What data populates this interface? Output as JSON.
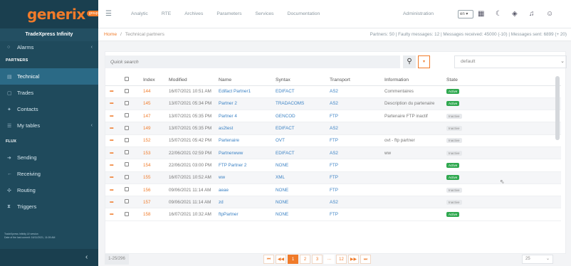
{
  "app": {
    "logo_text": "generix",
    "logo_badge": "group",
    "name": "TradeXpress Infinity",
    "version_line1": "TradeXpress Infinity UI version",
    "version_line2": "Date of the last commit: 16/11/2021, 11:05 AM"
  },
  "sidebar": {
    "alarms": "Alarms",
    "section_partners": "PARTNERS",
    "technical": "Technical",
    "trades": "Trades",
    "contacts": "Contacts",
    "my_tables": "My tables",
    "section_flux": "FLUX",
    "sending": "Sending",
    "receiving": "Receiving",
    "routing": "Routing",
    "triggers": "Triggers"
  },
  "topnav": {
    "items": [
      "Analytic",
      "RTE",
      "Archives",
      "Parameters",
      "Services",
      "Documentation"
    ],
    "administration": "Administration",
    "language": "en"
  },
  "breadcrumb": {
    "home": "Home",
    "separator": "/",
    "current": "Technical partners"
  },
  "stats": "Partners: 50   |   Faulty messages: 12   |   Messages received: 45000 (-10)   |   Messages sent: 6899 (+ 20)",
  "search": {
    "placeholder": "Quick search"
  },
  "view": {
    "selected": "default"
  },
  "table": {
    "headers": [
      "Index",
      "Modified",
      "Name",
      "Syntax",
      "Transport",
      "Information",
      "State"
    ],
    "rows": [
      {
        "index": "144",
        "modified": "16/07/2021 10:51 AM",
        "name": "Edifact Partner1",
        "syntax": "EDIFACT",
        "transport": "AS2",
        "information": "Commentaires",
        "state": "Active"
      },
      {
        "index": "145",
        "modified": "13/07/2021 05:34 PM",
        "name": "Partner 2",
        "syntax": "TRADACOMS",
        "transport": "AS2",
        "information": "Description du partenaire",
        "state": "Active"
      },
      {
        "index": "147",
        "modified": "13/07/2021 05:35 PM",
        "name": "Partner 4",
        "syntax": "GENCOD",
        "transport": "FTP",
        "information": "Partenaire FTP inactif",
        "state": "Inactive"
      },
      {
        "index": "149",
        "modified": "13/07/2021 05:35 PM",
        "name": "as2test",
        "syntax": "EDIFACT",
        "transport": "AS2",
        "information": "",
        "state": "Inactive"
      },
      {
        "index": "152",
        "modified": "15/07/2021 05:42 PM",
        "name": "Partenaire",
        "syntax": "OVT",
        "transport": "FTP",
        "information": "ovt - ftp partner",
        "state": "Inactive"
      },
      {
        "index": "153",
        "modified": "22/06/2021 02:59 PM",
        "name": "Partnerwww",
        "syntax": "EDIFACT",
        "transport": "AS2",
        "information": "ww",
        "state": "Inactive"
      },
      {
        "index": "154",
        "modified": "22/06/2021 03:00 PM",
        "name": "FTP Partner 2",
        "syntax": "NONE",
        "transport": "FTP",
        "information": "",
        "state": "Active"
      },
      {
        "index": "155",
        "modified": "16/07/2021 10:52 AM",
        "name": "ww",
        "syntax": "XML",
        "transport": "FTP",
        "information": "",
        "state": "Active"
      },
      {
        "index": "156",
        "modified": "09/06/2021 11:14 AM",
        "name": "aeae",
        "syntax": "NONE",
        "transport": "FTP",
        "information": "",
        "state": "Inactive"
      },
      {
        "index": "157",
        "modified": "09/06/2021 11:14 AM",
        "name": "zd",
        "syntax": "NONE",
        "transport": "AS2",
        "information": "",
        "state": "Inactive"
      },
      {
        "index": "158",
        "modified": "16/07/2021 10:32 AM",
        "name": "ftpPartner",
        "syntax": "NONE",
        "transport": "FTP",
        "information": "",
        "state": "Active"
      }
    ]
  },
  "footer": {
    "count": "1-25/296",
    "pages": [
      "1",
      "2",
      "3",
      "...",
      "12"
    ],
    "first": "⏮",
    "prev": "◀◀",
    "next": "▶▶",
    "last": "⏭",
    "page_size": "25"
  }
}
